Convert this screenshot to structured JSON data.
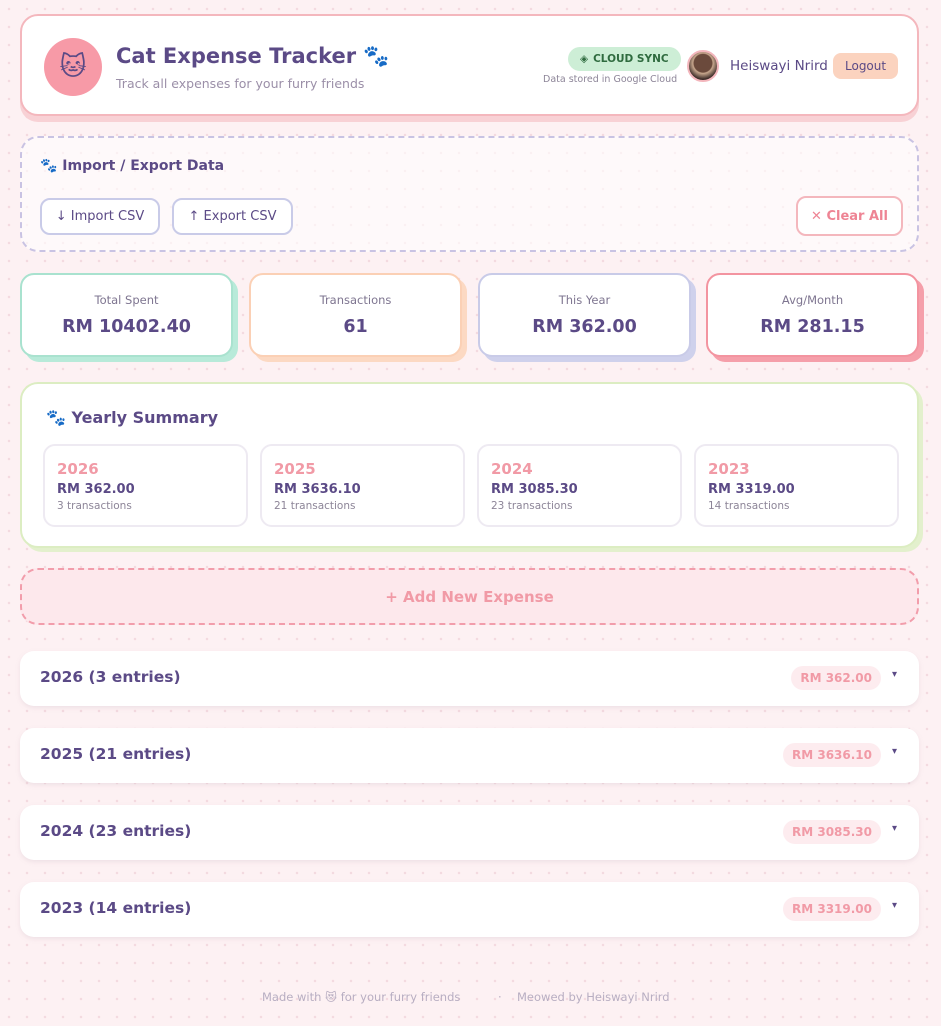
{
  "header": {
    "avatar_icon": "🐱",
    "title": "Cat Expense Tracker 🐾",
    "subtitle": "Track all expenses for your furry friends",
    "sync_icon": "◈",
    "sync_badge": "CLOUD SYNC",
    "sync_note": "Data stored in Google Cloud",
    "user_name": "Heiswayi Nrird",
    "logout_label": "Logout"
  },
  "import_export": {
    "title": "🐾 Import / Export Data",
    "import_label": "↓ Import CSV",
    "export_label": "↑ Export CSV",
    "clear_label": "✕ Clear All"
  },
  "stats": {
    "total_label": "Total Spent",
    "total_value": "RM 10402.40",
    "tx_label": "Transactions",
    "tx_value": "61",
    "year_label": "This Year",
    "year_value": "RM 362.00",
    "avg_label": "Avg/Month",
    "avg_value": "RM 281.15"
  },
  "yearly": {
    "title": "🐾 Yearly Summary",
    "cards": [
      {
        "year": "2026",
        "amount": "RM 362.00",
        "count": "3 transactions"
      },
      {
        "year": "2025",
        "amount": "RM 3636.10",
        "count": "21 transactions"
      },
      {
        "year": "2024",
        "amount": "RM 3085.30",
        "count": "23 transactions"
      },
      {
        "year": "2023",
        "amount": "RM 3319.00",
        "count": "14 transactions"
      }
    ]
  },
  "add_label": "+ Add New Expense",
  "sections": [
    {
      "label": "2026 (3 entries)",
      "total": "RM 362.00",
      "chevron": "▾"
    },
    {
      "label": "2025 (21 entries)",
      "total": "RM 3636.10",
      "chevron": "▾"
    },
    {
      "label": "2024 (23 entries)",
      "total": "RM 3085.30",
      "chevron": "▾"
    },
    {
      "label": "2023 (14 entries)",
      "total": "RM 3319.00",
      "chevron": "▾"
    }
  ],
  "footer": {
    "left": "Made with 😻 for your furry friends",
    "dot": "·",
    "right": "Meowed by Heiswayi Nrird"
  }
}
